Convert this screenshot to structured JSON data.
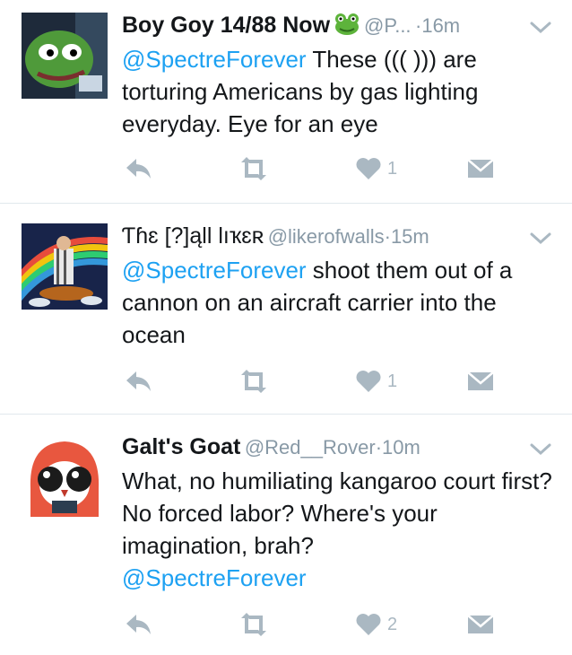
{
  "tweets": [
    {
      "name": "Boy Goy 14/88 Now",
      "badge_icon": "frog-emoji-icon",
      "handle": "@P...",
      "dot": "·",
      "time": "16m",
      "mention": "@SpectreForever",
      "text": " These ((( ))) are torturing Americans by gas lighting everyday. Eye for an eye",
      "like_count": "1"
    },
    {
      "name": "Ƭɦɛ [?]ąƖƖ Ɩıҡɛʀ",
      "handle": "@likerofwalls",
      "dot": "·",
      "time": "15m",
      "mention": "@SpectreForever",
      "text": " shoot them out of a cannon on an aircraft carrier into the ocean",
      "like_count": "1"
    },
    {
      "name": "Galt's Goat",
      "handle": "@Red__Rover",
      "dot": "·",
      "time": "10m",
      "text": "What, no humiliating kangaroo court first? No forced labor? Where's your imagination, brah?",
      "mention": "@SpectreForever",
      "like_count": "2"
    }
  ],
  "colors": {
    "mention": "#1da1f2",
    "meta": "#8899a6",
    "icon": "#aab8c2",
    "divider": "#e1e8ed"
  }
}
